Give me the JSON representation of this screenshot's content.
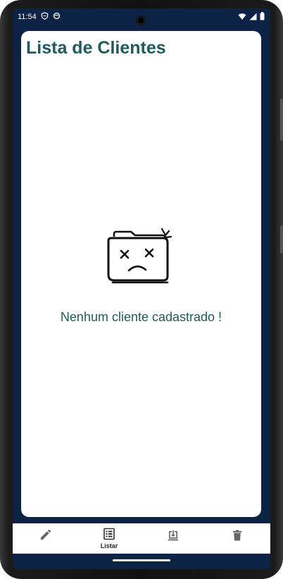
{
  "status_bar": {
    "time": "11:54",
    "left_icons": [
      "shield-icon",
      "sync-icon"
    ],
    "right_icons": [
      "wifi-icon",
      "signal-icon",
      "battery-icon"
    ]
  },
  "page": {
    "title": "Lista de Clientes",
    "empty_state": {
      "message": "Nenhum cliente cadastrado !",
      "icon": "sad-folder-icon"
    }
  },
  "bottom_nav": {
    "items": [
      {
        "icon": "pencil-icon",
        "label": ""
      },
      {
        "icon": "list-icon",
        "label": "Listar",
        "active": true
      },
      {
        "icon": "download-icon",
        "label": ""
      },
      {
        "icon": "trash-icon",
        "label": ""
      }
    ]
  },
  "colors": {
    "accent": "#1f5a5d",
    "background": "#0d2346"
  }
}
